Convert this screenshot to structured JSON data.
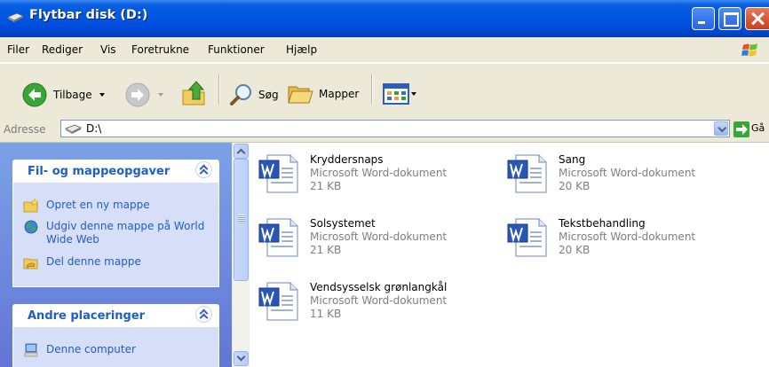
{
  "window": {
    "title": "Flytbar disk (D:)"
  },
  "menu": [
    "Filer",
    "Rediger",
    "Vis",
    "Foretrukne",
    "Funktioner",
    "Hjælp"
  ],
  "toolbar": {
    "back_label": "Tilbage",
    "search_label": "Søg",
    "folders_label": "Mapper"
  },
  "address": {
    "label": "Adresse",
    "value": "D:\\",
    "go_label": "Gå"
  },
  "tasks_panel": {
    "title": "Fil- og mappeopgaver",
    "items": [
      {
        "label": "Opret en ny mappe",
        "icon": "new-folder-icon"
      },
      {
        "label": "Udgiv denne mappe på World Wide Web",
        "icon": "publish-web-icon"
      },
      {
        "label": "Del denne mappe",
        "icon": "share-folder-icon"
      }
    ]
  },
  "places_panel": {
    "title": "Andre placeringer",
    "items": [
      {
        "label": "Denne computer",
        "icon": "my-computer-icon"
      }
    ]
  },
  "files": [
    {
      "name": "Kryddersnaps",
      "type": "Microsoft Word-dokument",
      "size": "21 KB"
    },
    {
      "name": "Sang",
      "type": "Microsoft Word-dokument",
      "size": "20 KB"
    },
    {
      "name": "Solsystemet",
      "type": "Microsoft Word-dokument",
      "size": "21 KB"
    },
    {
      "name": "Tekstbehandling",
      "type": "Microsoft Word-dokument",
      "size": "20 KB"
    },
    {
      "name": "Vendsysselsk grønlangkål",
      "type": "Microsoft Word-dokument",
      "size": "11 KB"
    }
  ],
  "colors": {
    "titlebar": "#0055e5",
    "task_link": "#215dc6",
    "pane_gradient_top": "#7ba2e7",
    "pane_gradient_bottom": "#6375d6"
  }
}
